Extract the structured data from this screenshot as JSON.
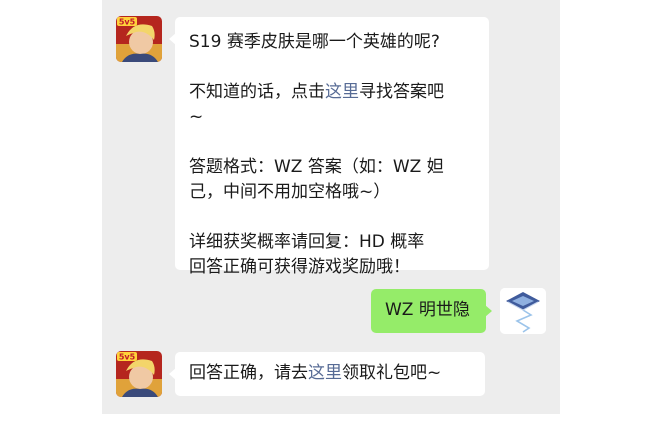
{
  "colors": {
    "chat_background": "#ededed",
    "incoming_bubble": "#ffffff",
    "outgoing_bubble": "#95ec69",
    "link": "#576b95"
  },
  "messages": [
    {
      "sender": "official-account",
      "avatar_icon": "hero-portrait-icon",
      "avatar_badge": "5v5",
      "paragraphs": [
        {
          "text": "S19 赛季皮肤是哪一个英雄的呢?"
        },
        {
          "before": "不知道的话，点击",
          "link": "这里",
          "after": "寻找答案吧\n~"
        },
        {
          "text": "答题格式：WZ 答案（如：WZ 妲\n己，中间不用加空格哦~）"
        },
        {
          "text": "详细获奖概率请回复：HD 概率\n回答正确可获得游戏奖励哦！"
        }
      ]
    },
    {
      "sender": "user",
      "avatar_icon": "diamond-logo-icon",
      "text": "WZ 明世隐"
    },
    {
      "sender": "official-account",
      "avatar_icon": "hero-portrait-icon",
      "avatar_badge": "5v5",
      "before": "回答正确，请去",
      "link": "这里",
      "after": "领取礼包吧~"
    }
  ]
}
